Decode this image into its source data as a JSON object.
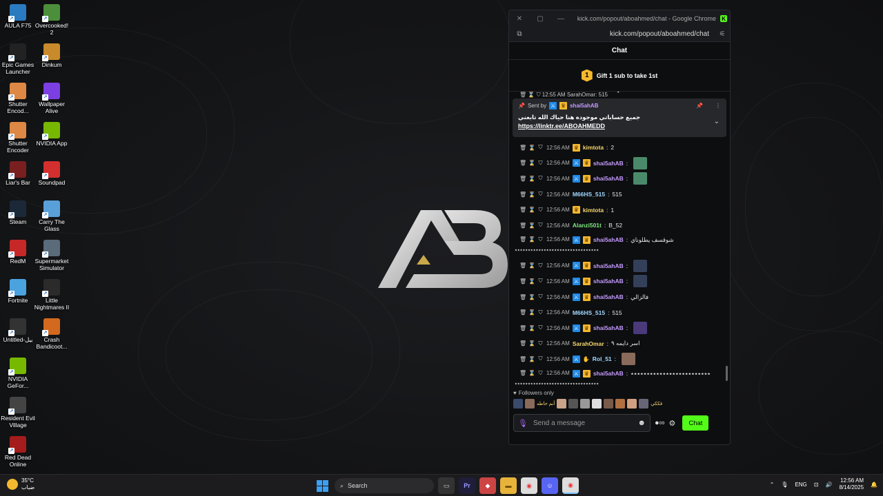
{
  "desktop": {
    "col1": [
      {
        "label": "AULA F75",
        "icon": "keyboard-app-icon",
        "color": "#2a7bbf"
      },
      {
        "label": "Epic Games Launcher",
        "icon": "epic-games-icon",
        "color": "#222"
      },
      {
        "label": "Shutter Encod...",
        "icon": "shutter-encoder-icon",
        "color": "#d84"
      },
      {
        "label": "Shutter Encoder",
        "icon": "shutter-encoder-icon",
        "color": "#d84"
      },
      {
        "label": "Liar's Bar",
        "icon": "liars-bar-icon",
        "color": "#7a1f1f"
      },
      {
        "label": "Steam",
        "icon": "steam-icon",
        "color": "#1b2838"
      },
      {
        "label": "RedM",
        "icon": "redm-icon",
        "color": "#c62828"
      },
      {
        "label": "Fortnite",
        "icon": "fortnite-icon",
        "color": "#4aa3df"
      },
      {
        "label": "Untitled-بيل",
        "icon": "file-icon",
        "color": "#333"
      },
      {
        "label": "NVIDIA GeFor...",
        "icon": "nvidia-icon",
        "color": "#76b900"
      },
      {
        "label": "Resident Evil Village",
        "icon": "resident-evil-icon",
        "color": "#444"
      },
      {
        "label": "Red Dead Online",
        "icon": "red-dead-icon",
        "color": "#a51c1c"
      }
    ],
    "col2": [
      {
        "label": "Overcooked! 2",
        "icon": "overcooked-icon",
        "color": "#4c8f3a"
      },
      {
        "label": "Dinkum",
        "icon": "dinkum-icon",
        "color": "#c98a2b"
      },
      {
        "label": "Wallpaper Alive",
        "icon": "wallpaper-alive-icon",
        "color": "#7b3fe4"
      },
      {
        "label": "NVIDIA App",
        "icon": "nvidia-icon",
        "color": "#76b900"
      },
      {
        "label": "Soundpad",
        "icon": "soundpad-icon",
        "color": "#d32f2f"
      },
      {
        "label": "Carry The Glass",
        "icon": "carry-glass-icon",
        "color": "#5aa0d8"
      },
      {
        "label": "Supermarket Simulator",
        "icon": "supermarket-icon",
        "color": "#5a6b7a"
      },
      {
        "label": "Little Nightmares II",
        "icon": "little-nightmares-icon",
        "color": "#2b2b2b"
      },
      {
        "label": "Crash Bandicoot...",
        "icon": "crash-icon",
        "color": "#d2691e"
      }
    ]
  },
  "browser": {
    "title": "kick.com/popout/aboahmed/chat - Google Chrome",
    "url": "kick.com/popout/aboahmed/chat",
    "accent": "#53fc18"
  },
  "chat": {
    "header": "Chat",
    "gift_rank": "1",
    "gift_text": "Gift 1 sub to take 1st",
    "cut_row": "12:55 AM SarahOmar: 515",
    "pinned": {
      "sent_by": "Sent by",
      "user": "shai5ahAB",
      "message": "جميع حساباتي موجوده هنا حياك الله تابعني",
      "link": "https://linktr.ee/ABOAHMEDD"
    },
    "messages": [
      {
        "time": "12:56 AM",
        "user": "kimtota",
        "color": "#f5d76e",
        "badges": [
          "crown"
        ],
        "text": "2"
      },
      {
        "time": "12:56 AM",
        "user": "shai5ahAB",
        "color": "#c59bff",
        "badges": [
          "mod",
          "crown"
        ],
        "text": "",
        "emote": "#4a8a6a"
      },
      {
        "time": "12:56 AM",
        "user": "shai5ahAB",
        "color": "#c59bff",
        "badges": [
          "mod",
          "crown"
        ],
        "text": "",
        "emote": "#4a8a6a"
      },
      {
        "time": "12:56 AM",
        "user": "M66HS_515",
        "color": "#9fd8ff",
        "badges": [],
        "text": "515"
      },
      {
        "time": "12:56 AM",
        "user": "kimtota",
        "color": "#f5d76e",
        "badges": [
          "crown"
        ],
        "text": "1"
      },
      {
        "time": "12:56 AM",
        "user": "Alanzi501t",
        "color": "#7ee87e",
        "badges": [],
        "text": "B_52"
      }
    ],
    "tall1": {
      "time": "12:56 AM",
      "user": "shai5ahAB",
      "text": "شوقسف يطلوناي",
      "wrap": "٭٭٭٭٭٭٭٭٭٭٭٭٭٭٭٭٭٭٭٭٭٭٭٭٭٭٭٭٭٭٭٭"
    },
    "messages2": [
      {
        "time": "12:56 AM",
        "user": "shai5ahAB",
        "color": "#c59bff",
        "badges": [
          "mod",
          "crown"
        ],
        "text": "",
        "emote": "#34405a"
      },
      {
        "time": "12:56 AM",
        "user": "shai5ahAB",
        "color": "#c59bff",
        "badges": [
          "mod",
          "crown"
        ],
        "text": "",
        "emote": "#34405a"
      },
      {
        "time": "12:56 AM",
        "user": "shai5ahAB",
        "color": "#c59bff",
        "badges": [
          "mod",
          "crown"
        ],
        "text": "فالزالي"
      },
      {
        "time": "12:56 AM",
        "user": "M66HS_515",
        "color": "#9fd8ff",
        "badges": [],
        "text": "515"
      },
      {
        "time": "12:56 AM",
        "user": "shai5ahAB",
        "color": "#c59bff",
        "badges": [
          "mod",
          "crown"
        ],
        "text": "",
        "emote": "#4a3a7a"
      },
      {
        "time": "12:56 AM",
        "user": "SarahOmar",
        "color": "#f5d76e",
        "badges": [],
        "text": "اسر دايمه ٩"
      },
      {
        "time": "12:56 AM",
        "user": "Rol_51",
        "color": "#9fd8ff",
        "badges": [
          "mod",
          "hand"
        ],
        "text": "",
        "emote": "#8a6a5a"
      }
    ],
    "tall2": {
      "time": "12:56 AM",
      "user": "shai5ahAB",
      "text": "٭٭٭٭٭٭٭٭٭٭٭٭٭٭٭٭٭٭٭٭٭٭٭٭٭",
      "wrap": "٭٭٭٭٭٭٭٭٭٭٭٭٭٭٭٭٭٭٭٭٭٭٭٭٭٭٭٭٭٭٭٭"
    },
    "followers_only": "Followers only",
    "viewer_label": "فككي",
    "viewer_label2": "أنم حاطه",
    "placeholder": "Send a message",
    "send_label": "Chat"
  },
  "taskbar": {
    "temp": "35°C",
    "weather": "ضباب",
    "search": "Search",
    "lang": "ENG",
    "time": "12:56 AM",
    "date": "8/14/2025"
  }
}
